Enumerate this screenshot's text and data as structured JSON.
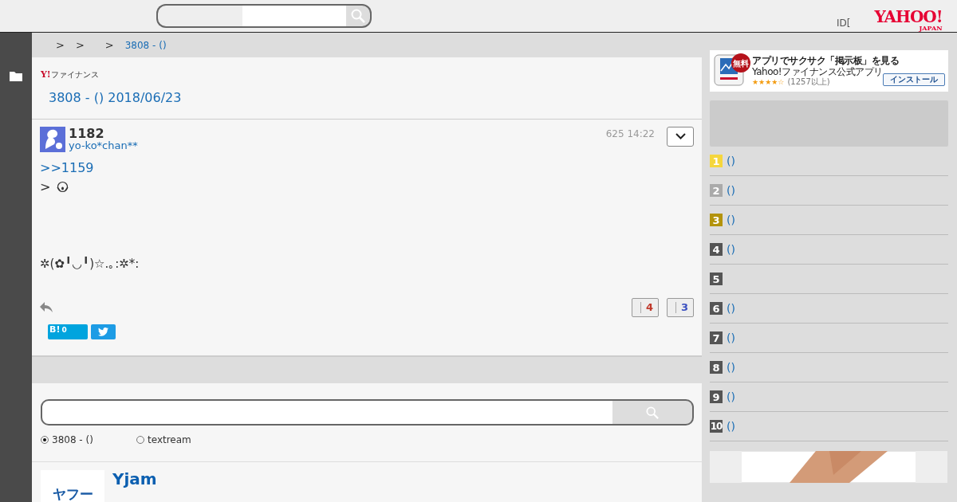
{
  "header": {
    "account_text": "ID[",
    "logo": {
      "main": "YAHOO!",
      "sub": "JAPAN"
    }
  },
  "breadcrumb": [
    {
      "kind": "separator",
      "text": ">"
    },
    {
      "kind": "separator",
      "text": ">"
    },
    {
      "kind": "separator",
      "text": ">"
    },
    {
      "kind": "link",
      "text": "3808 - ()"
    }
  ],
  "board": {
    "logo": {
      "mark": "Y!",
      "name": "ファイナンス"
    },
    "title": "3808 - () 2018/06/23"
  },
  "post": {
    "number": "1182",
    "author": "yo-ko*chan**",
    "time": "625 14:22",
    "lines": [
      {
        "kind": "link",
        "text": ">>1159"
      },
      {
        "kind": "emoji",
        "text": ">"
      },
      {
        "kind": "gap"
      },
      {
        "kind": "text",
        "text": "✲(✿╹◡╹)☆.｡:✲*:"
      }
    ],
    "votes": [
      {
        "count": "4",
        "color": "#c0392b"
      },
      {
        "count": "3",
        "color": "#3a4fc0"
      }
    ],
    "hatena": {
      "label": "B!",
      "count": "0"
    }
  },
  "search": {
    "scopes": [
      {
        "label": "3808 - ()",
        "selected": true
      },
      {
        "label": "textream",
        "selected": false
      }
    ]
  },
  "promo": {
    "logo_text": "ヤフー",
    "title": "Yjam"
  },
  "sidebar": {
    "app_ad": {
      "badge": "無料",
      "headline": "アプリでサクサク「掲示板」を見る",
      "app_name": "Yahoo!ファイナンス公式アプリ",
      "stars": 4,
      "reviews": "(1257以上)",
      "install": "インストール"
    },
    "ranking": [
      {
        "rank": "1",
        "color": "#f5d63d",
        "title": "()"
      },
      {
        "rank": "2",
        "color": "#aaaaaa",
        "title": "()"
      },
      {
        "rank": "3",
        "color": "#b3930c",
        "title": "()"
      },
      {
        "rank": "4",
        "color": "#555555",
        "title": "()"
      },
      {
        "rank": "5",
        "color": "#555555"
      },
      {
        "rank": "6",
        "color": "#555555",
        "title": "()"
      },
      {
        "rank": "7",
        "color": "#555555",
        "title": "()"
      },
      {
        "rank": "8",
        "color": "#555555",
        "title": "()"
      },
      {
        "rank": "9",
        "color": "#555555",
        "title": "()"
      },
      {
        "rank": "10",
        "color": "#555555",
        "title": "()"
      }
    ]
  }
}
